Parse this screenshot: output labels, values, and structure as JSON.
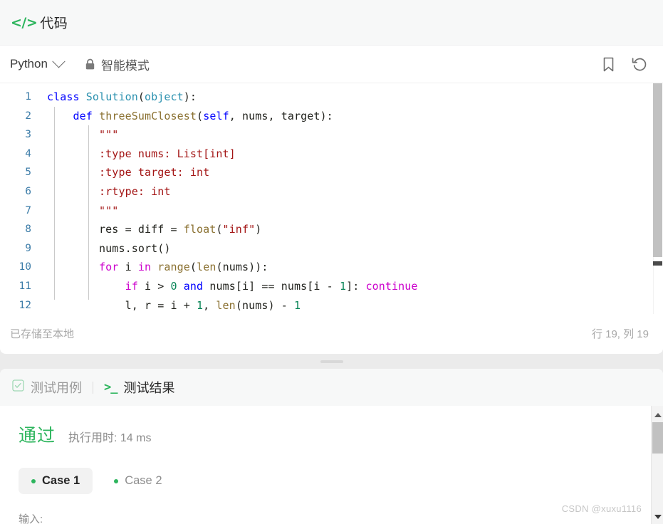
{
  "header": {
    "code_icon": "code-brackets-icon",
    "title": "代码"
  },
  "toolbar": {
    "language": "Python",
    "chevron_icon": "chevron-down-icon",
    "lock_icon": "lock-icon",
    "smart_mode_label": "智能模式",
    "bookmark_icon": "bookmark-icon",
    "reset_icon": "reset-icon"
  },
  "editor": {
    "lines": [
      {
        "n": "1",
        "html": "<span class=\"kw\">class</span> <span class=\"cls\">Solution</span>(<span class=\"cls\">object</span>):"
      },
      {
        "n": "2",
        "html": "    <span class=\"kw\">def</span> <span class=\"fn\">threeSumClosest</span>(<span class=\"kw\">self</span>, nums, target):"
      },
      {
        "n": "3",
        "html": "        <span class=\"doc\">\"\"\"</span>"
      },
      {
        "n": "4",
        "html": "        <span class=\"doc\">:type nums: List[int]</span>"
      },
      {
        "n": "5",
        "html": "        <span class=\"doc\">:type target: int</span>"
      },
      {
        "n": "6",
        "html": "        <span class=\"doc\">:rtype: int</span>"
      },
      {
        "n": "7",
        "html": "        <span class=\"doc\">\"\"\"</span>"
      },
      {
        "n": "8",
        "html": "        res = diff = <span class=\"builtin\">float</span>(<span class=\"str\">\"inf\"</span>)"
      },
      {
        "n": "9",
        "html": "        nums.sort()"
      },
      {
        "n": "10",
        "html": "        <span class=\"kw2\">for</span> i <span class=\"kw2\">in</span> <span class=\"builtin\">range</span>(<span class=\"builtin\">len</span>(nums)):"
      },
      {
        "n": "11",
        "html": "            <span class=\"kw2\">if</span> i &gt; <span class=\"num\">0</span> <span class=\"kw\">and</span> nums[i] == nums[i - <span class=\"num\">1</span>]: <span class=\"kw2\">continue</span>"
      },
      {
        "n": "12",
        "html": "            l, r = i + <span class=\"num\">1</span>, <span class=\"builtin\">len</span>(nums) - <span class=\"num\">1</span>"
      }
    ]
  },
  "status": {
    "saved_text": "已存储至本地",
    "cursor_text": "行 19, 列 19"
  },
  "result": {
    "tabs": [
      {
        "label": "测试用例",
        "icon": "checkbox-icon",
        "active": false
      },
      {
        "label": "测试结果",
        "icon": "terminal-icon",
        "active": true
      }
    ],
    "verdict": "通过",
    "runtime": "执行用时: 14 ms",
    "cases": [
      {
        "label": "Case 1",
        "selected": true
      },
      {
        "label": "Case 2",
        "selected": false
      }
    ],
    "input_label": "输入:"
  },
  "watermark": "CSDN @xuxu1116",
  "colors": {
    "accent_green": "#2db55d",
    "keyword_blue": "#0000ff",
    "keyword_magenta": "#cc00cc",
    "string_red": "#a31515",
    "number_green": "#098658",
    "builtin_olive": "#8a7030",
    "class_teal": "#2b91af",
    "linenum_blue": "#3c7ca8"
  }
}
